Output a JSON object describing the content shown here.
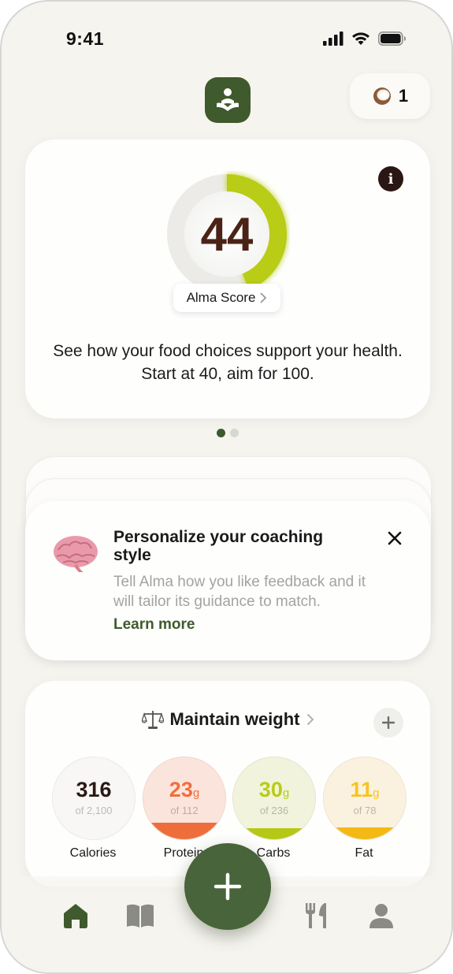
{
  "status_bar": {
    "time": "9:41"
  },
  "header": {
    "coin_count": "1",
    "coin_icon": "coconut-icon",
    "logo_icon": "alma-logo-icon"
  },
  "score_card": {
    "score": "44",
    "score_fraction": 0.44,
    "pill_label": "Alma Score",
    "description": "See how your food choices support your health. Start at 40, aim for 100.",
    "ring_color": "#b9cc17"
  },
  "pager": {
    "pages": 2,
    "active": 0
  },
  "coach_card": {
    "title": "Personalize your coaching style",
    "body": "Tell Alma how you like feedback and it will tailor its guidance to match.",
    "link": "Learn more"
  },
  "goal": {
    "icon": "scale-icon",
    "label": "Maintain weight"
  },
  "macros": [
    {
      "name": "calories",
      "value": "316",
      "unit": "",
      "of": "of 2,100",
      "label": "Calories",
      "fraction": 0.0,
      "color": "#2a1a14",
      "bg": "#f8f7f5",
      "fill": "#cccccc"
    },
    {
      "name": "protein",
      "value": "23",
      "unit": "g",
      "of": "of 112",
      "label": "Protein",
      "fraction": 0.2,
      "color": "#ef6f3f",
      "bg": "#fbe4dc",
      "fill": "#ee6e3b"
    },
    {
      "name": "carbs",
      "value": "30",
      "unit": "g",
      "of": "of 236",
      "label": "Carbs",
      "fraction": 0.13,
      "color": "#b9cc17",
      "bg": "#f1f3dc",
      "fill": "#b5c815"
    },
    {
      "name": "fat",
      "value": "11",
      "unit": "g",
      "of": "of 78",
      "label": "Fat",
      "fraction": 0.14,
      "color": "#f6c420",
      "bg": "#fbf1df",
      "fill": "#f5b915"
    }
  ],
  "tabs": [
    {
      "name": "home",
      "icon": "home-icon",
      "active": true
    },
    {
      "name": "learn",
      "icon": "book-icon",
      "active": false
    },
    {
      "name": "meals",
      "icon": "fork-knife-icon",
      "active": false
    },
    {
      "name": "profile",
      "icon": "person-icon",
      "active": false
    }
  ],
  "colors": {
    "brand": "#3f5a2c",
    "background": "#f6f4ef"
  }
}
